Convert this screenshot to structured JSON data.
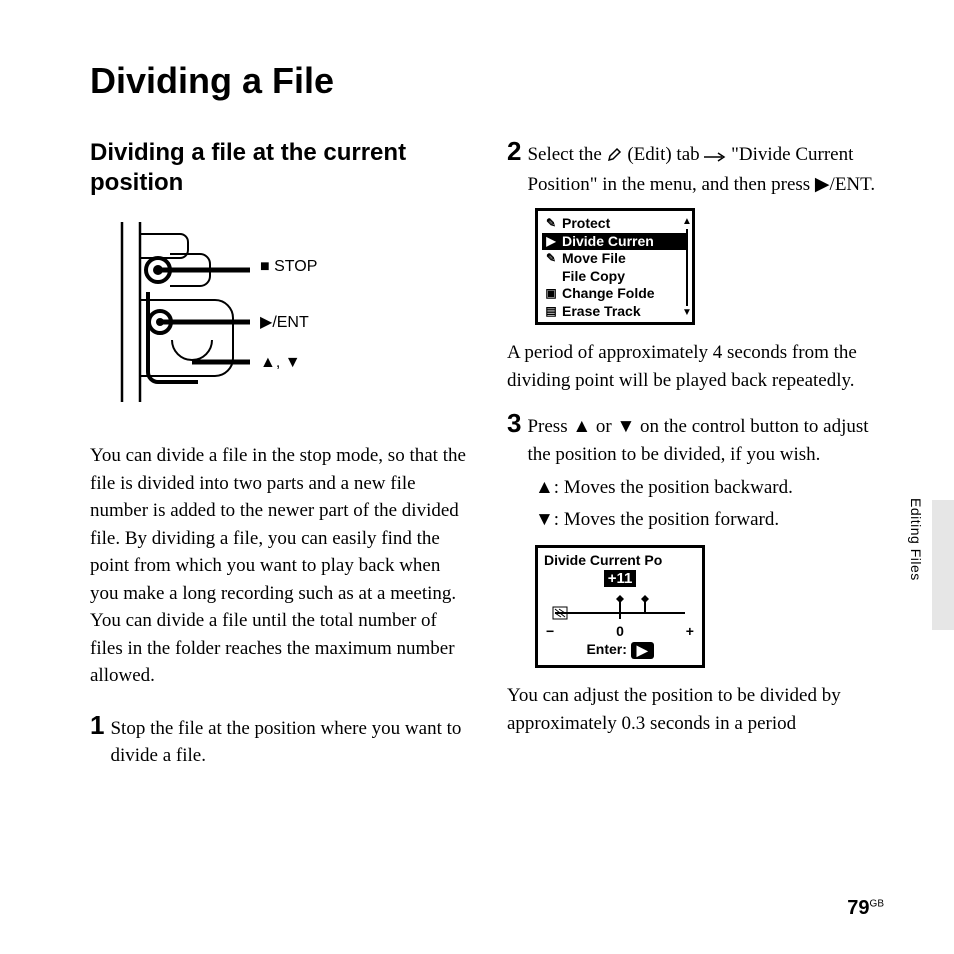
{
  "page": {
    "title": "Dividing a File",
    "section_label": "Editing Files",
    "page_number": "79",
    "page_number_suffix": "GB"
  },
  "left": {
    "subtitle": "Dividing a file at the current position",
    "diagram_labels": {
      "stop": "STOP",
      "ent": "/ENT",
      "updown": ","
    },
    "intro": "You can divide a file in the stop mode, so that the file is divided into two parts and a new file number is added to the newer part of the divided file. By dividing a file, you can easily find the point from which you want to play back when you make a long recording such as at a meeting. You can divide a file until the total number of files in the folder reaches the maximum number allowed.",
    "step1_num": "1",
    "step1_text": "Stop the file at the position where you want to divide a file."
  },
  "right": {
    "step2_num": "2",
    "step2_pre": "Select the ",
    "step2_edit_label": " (Edit) tab ",
    "step2_post": " \"Divide Current Position\" in the menu, and then press ",
    "step2_ent": "/ENT.",
    "menu": {
      "items": [
        {
          "icon": "pencil",
          "label": "Protect",
          "selected": false
        },
        {
          "icon": "play",
          "label": "Divide Curren",
          "selected": true
        },
        {
          "icon": "pencil",
          "label": "Move File",
          "selected": false
        },
        {
          "icon": "",
          "label": "File Copy",
          "selected": false
        },
        {
          "icon": "disp",
          "label": "Change Folde",
          "selected": false
        },
        {
          "icon": "disp2",
          "label": "Erase Track",
          "selected": false
        }
      ]
    },
    "after_menu": "A period of approximately 4 seconds from the dividing point will be played back repeatedly.",
    "step3_num": "3",
    "step3_text": "Press ▲ or ▼ on the control button to adjust the position to be divided, if you wish.",
    "step3_sub_up": "▲: Moves the position backward.",
    "step3_sub_down": "▼: Moves the position forward.",
    "divide_screen": {
      "title": "Divide Current Po",
      "value": "+11",
      "scale_minus": "−",
      "scale_zero": "0",
      "scale_plus": "+",
      "enter_label": "Enter:"
    },
    "after_divide": "You can adjust the position to be divided by approximately 0.3 seconds in a period"
  }
}
